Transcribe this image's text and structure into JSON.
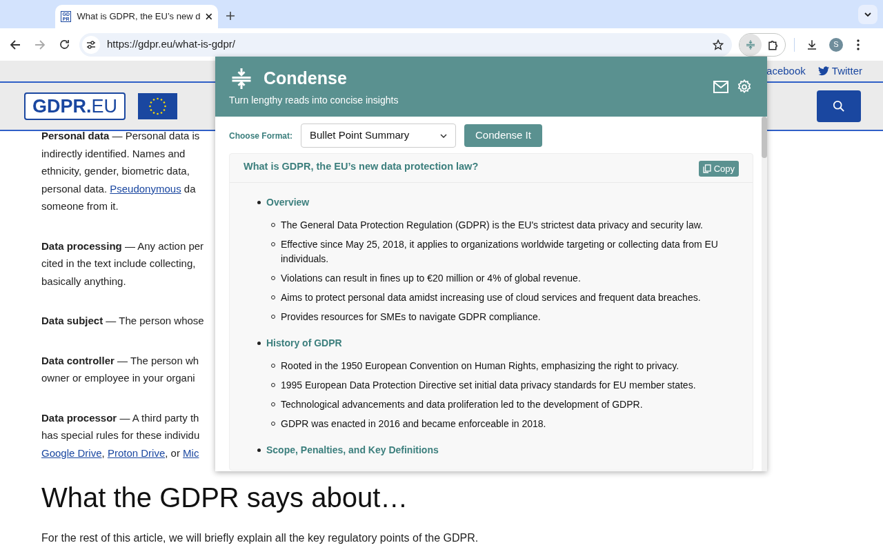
{
  "browser": {
    "tab": {
      "title": "What is GDPR, the EU’s new d",
      "favicon": "GD PR",
      "selected": true
    },
    "url": "https://gdpr.eu/what-is-gdpr/",
    "profile_initial": "S"
  },
  "site": {
    "social_links": [
      "acebook",
      "Twitter"
    ],
    "logo": {
      "main": "GDPR.",
      "suffix": "EU"
    }
  },
  "article": {
    "paragraphs": [
      {
        "lines": [
          [
            {
              "kind": "text",
              "text": "**Personal data** — Personal data is"
            }
          ],
          [
            {
              "kind": "text",
              "text": "indirectly identified. Names and"
            }
          ],
          [
            {
              "kind": "text",
              "text": "ethnicity, gender, biometric data,"
            }
          ],
          [
            {
              "kind": "text",
              "text": "personal data. "
            },
            {
              "kind": "link",
              "text": "Pseudonymous"
            },
            {
              "kind": "text",
              "text": " da"
            }
          ],
          [
            {
              "kind": "text",
              "text": "someone from it."
            }
          ]
        ]
      },
      {
        "lines": [
          [
            {
              "kind": "text",
              "text": "**Data processing** — Any action per"
            }
          ],
          [
            {
              "kind": "text",
              "text": "cited in the text include collecting,"
            }
          ],
          [
            {
              "kind": "text",
              "text": "basically anything."
            }
          ]
        ]
      },
      {
        "lines": [
          [
            {
              "kind": "text",
              "text": "**Data subject** — The person whose"
            }
          ]
        ]
      },
      {
        "lines": [
          [
            {
              "kind": "text",
              "text": "**Data controller** — The person wh"
            }
          ],
          [
            {
              "kind": "text",
              "text": "owner or employee in your organi"
            }
          ]
        ]
      },
      {
        "lines": [
          [
            {
              "kind": "text",
              "text": "**Data processor** — A third party th"
            }
          ],
          [
            {
              "kind": "text",
              "text": "has special rules for these individu"
            }
          ],
          [
            {
              "kind": "link",
              "text": "Google Drive"
            },
            {
              "kind": "text",
              "text": ", "
            },
            {
              "kind": "link",
              "text": "Proton Drive"
            },
            {
              "kind": "text",
              "text": ", or "
            },
            {
              "kind": "link",
              "text": "Mic"
            }
          ]
        ]
      }
    ],
    "heading": "What the GDPR says about…",
    "intro": "For the rest of this article, we will briefly explain all the key regulatory points of the GDPR."
  },
  "popup": {
    "title": "Condense",
    "subtitle": "Turn lengthy reads into concise insights",
    "format_label": "Choose Format:",
    "format_value": "Bullet Point Summary",
    "action": "Condense It",
    "summary": {
      "title": "What is GDPR, the EU’s new data protection law?",
      "copy": "Copy",
      "sections": [
        {
          "heading": "Overview",
          "items": [
            "The General Data Protection Regulation (GDPR) is the EU's strictest data privacy and security law.",
            "Effective since May 25, 2018, it applies to organizations worldwide targeting or collecting data from EU individuals.",
            "Violations can result in fines up to €20 million or 4% of global revenue.",
            "Aims to protect personal data amidst increasing use of cloud services and frequent data breaches.",
            "Provides resources for SMEs to navigate GDPR compliance."
          ]
        },
        {
          "heading": "History of GDPR",
          "items": [
            "Rooted in the 1950 European Convention on Human Rights, emphasizing the right to privacy.",
            "1995 European Data Protection Directive set initial data privacy standards for EU member states.",
            "Technological advancements and data proliferation led to the development of GDPR.",
            "GDPR was enacted in 2016 and became enforceable in 2018."
          ]
        },
        {
          "heading": "Scope, Penalties, and Key Definitions"
        }
      ]
    }
  }
}
